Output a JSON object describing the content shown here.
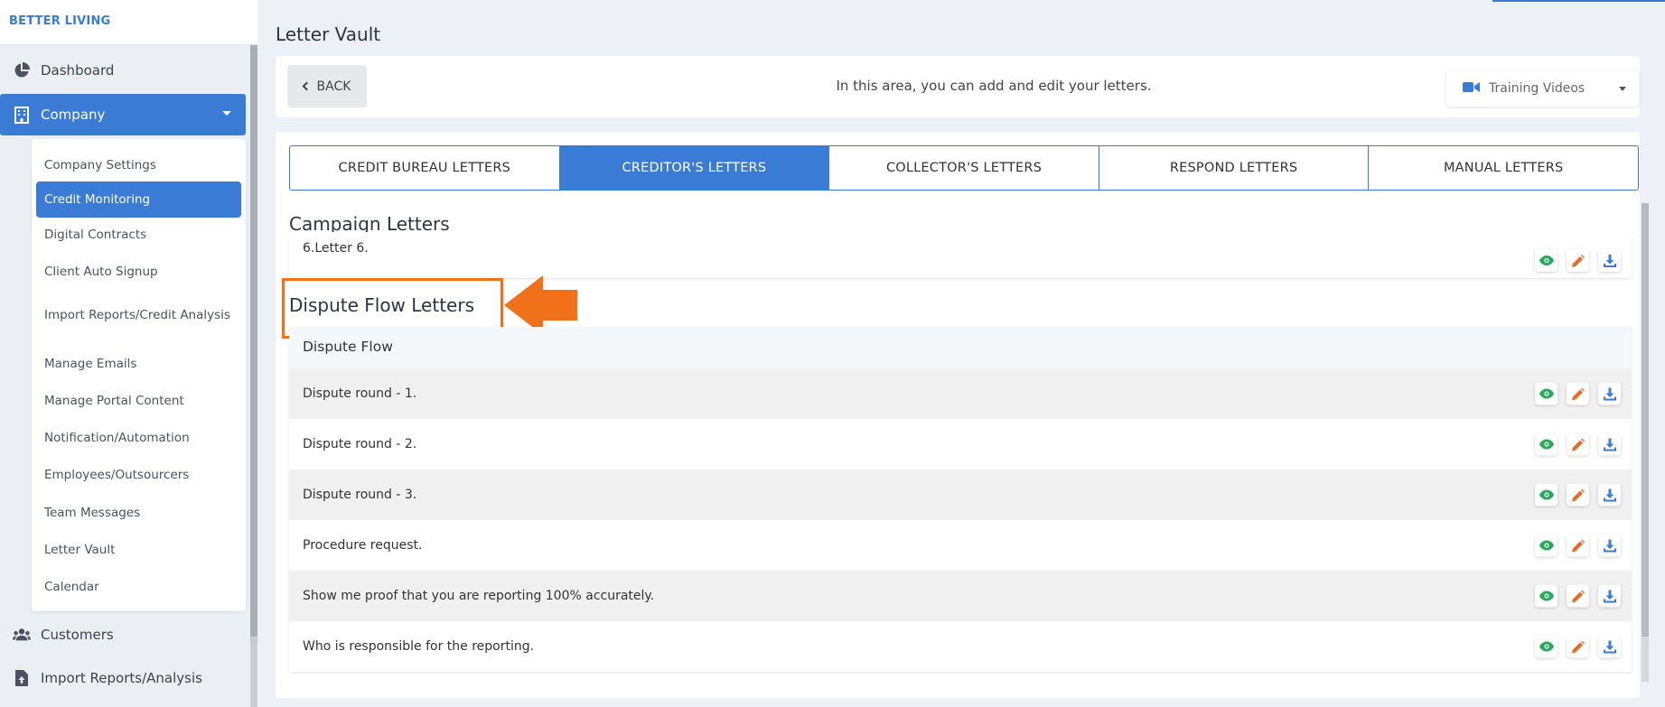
{
  "brand": "BETTER LIVING",
  "sidebar": {
    "items": [
      {
        "label": "Dashboard",
        "icon": "pie-chart-icon"
      },
      {
        "label": "Company",
        "icon": "building-icon"
      },
      {
        "label": "Customers",
        "icon": "users-icon"
      },
      {
        "label": "Import Reports/Analysis",
        "icon": "file-upload-icon"
      }
    ],
    "submenu": [
      "Company Settings",
      "Credit Monitoring",
      "Digital Contracts",
      "Client Auto Signup",
      "Import Reports/Credit Analysis",
      "Manage Emails",
      "Manage Portal Content",
      "Notification/Automation",
      "Employees/Outsourcers",
      "Team Messages",
      "Letter Vault",
      "Calendar"
    ]
  },
  "page": {
    "title": "Letter Vault",
    "back_label": "BACK",
    "info": "In this area, you can add and edit your letters.",
    "training_label": "Training Videos"
  },
  "tabs": [
    "CREDIT BUREAU LETTERS",
    "CREDITOR'S LETTERS",
    "COLLECTOR'S LETTERS",
    "RESPOND LETTERS",
    "MANUAL LETTERS"
  ],
  "campaign": {
    "title": "Campaign Letters",
    "rows": [
      "6.Letter 6."
    ]
  },
  "dispute": {
    "title": "Dispute Flow Letters",
    "group": "Dispute Flow",
    "rows": [
      "Dispute round - 1.",
      "Dispute round - 2.",
      "Dispute round - 3.",
      "Procedure request.",
      "Show me proof that you are reporting 100% accurately.",
      "Who is responsible for the reporting."
    ]
  },
  "colors": {
    "accent": "#3a7bd5",
    "callout": "#f07119",
    "view": "#27a85a",
    "edit": "#e8692a",
    "download": "#3a7bd5"
  }
}
